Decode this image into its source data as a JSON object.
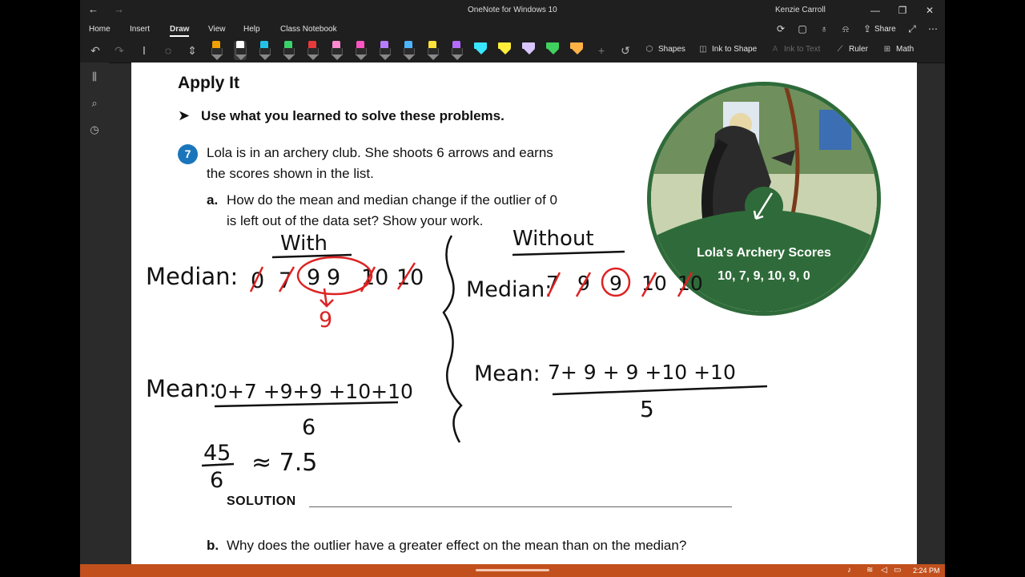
{
  "window": {
    "title": "OneNote for Windows 10",
    "user": "Kenzie Carroll"
  },
  "menu": {
    "items": [
      "Home",
      "Insert",
      "Draw",
      "View",
      "Help",
      "Class Notebook"
    ],
    "active": "Draw",
    "share_label": "Share"
  },
  "ribbon": {
    "pen_colors": [
      "#f0a000",
      "#ffffff",
      "#21c4e8",
      "#3ad36a",
      "#e83a3a",
      "#ff8ad0",
      "#ff55c4",
      "#b57cff",
      "#4fb4ff",
      "#ffe23a",
      "#b36cff"
    ],
    "highlighter_colors": [
      "#39e6ff",
      "#ffee3a",
      "#d9c6ff",
      "#3fd25e",
      "#ffb347"
    ],
    "shapes_label": "Shapes",
    "ink_to_shape_label": "Ink to Shape",
    "ink_to_text_label": "Ink to Text",
    "ruler_label": "Ruler",
    "math_label": "Math"
  },
  "page": {
    "section_title": "Apply It",
    "instruction": "Use what you learned to solve these problems.",
    "question_number": "7",
    "question_line1": "Lola is in an archery club. She shoots 6 arrows and earns",
    "question_line2": "the scores shown in the list.",
    "part_a_letter": "a.",
    "part_a_line1": "How do the mean and median change if the outlier of 0",
    "part_a_line2": "is left out of the data set? Show your work.",
    "solution_label": "SOLUTION",
    "part_b_letter": "b.",
    "part_b": "Why does the outlier have a greater effect on the mean than on the median?",
    "badge_title": "Lola's Archery Scores",
    "badge_values": "10, 7, 9, 10, 9, 0"
  },
  "ink": {
    "with_label": "With",
    "without_label": "Without",
    "median_label": "Median:",
    "mean_label": "Mean:",
    "with_median_values": [
      "0",
      "7",
      "9",
      "9",
      "10",
      "10"
    ],
    "with_median_result": "9",
    "with_mean_numerator": "0+7 +9+9 +10+10",
    "with_mean_denominator": "6",
    "with_mean_fraction_num": "45",
    "with_mean_fraction_den": "6",
    "with_mean_approx": "≈ 7.5",
    "without_median_values": [
      "7",
      "9",
      "9",
      "10",
      "10"
    ],
    "without_mean_numerator": "7+ 9 + 9 +10 +10",
    "without_mean_denominator": "5"
  },
  "taskbar": {
    "time": "2:24 PM"
  }
}
